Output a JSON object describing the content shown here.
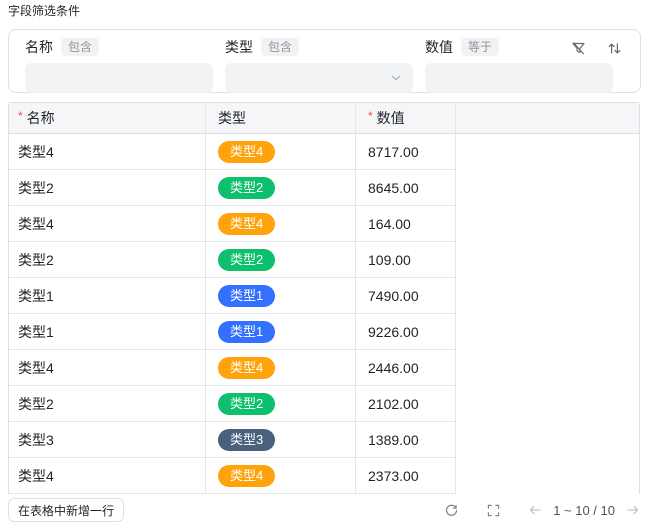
{
  "page": {
    "title": "字段筛选条件"
  },
  "filter": {
    "fields": [
      {
        "label": "名称",
        "operator": "包含",
        "control": "text-input",
        "value": ""
      },
      {
        "label": "类型",
        "operator": "包含",
        "control": "select",
        "value": ""
      },
      {
        "label": "数值",
        "operator": "等于",
        "control": "text-input",
        "value": ""
      }
    ]
  },
  "table": {
    "columns": [
      {
        "label": "名称",
        "required": true
      },
      {
        "label": "类型",
        "required": false
      },
      {
        "label": "数值",
        "required": true
      },
      {
        "label": "",
        "required": false
      }
    ],
    "badge_colors": {
      "类型1": "#3370FF",
      "类型2": "#0DC06E",
      "类型3": "#4A617E",
      "类型4": "#FFA30D"
    },
    "rows": [
      {
        "name": "类型4",
        "type": "类型4",
        "value": "8717.00"
      },
      {
        "name": "类型2",
        "type": "类型2",
        "value": "8645.00"
      },
      {
        "name": "类型4",
        "type": "类型4",
        "value": "164.00"
      },
      {
        "name": "类型2",
        "type": "类型2",
        "value": "109.00"
      },
      {
        "name": "类型1",
        "type": "类型1",
        "value": "7490.00"
      },
      {
        "name": "类型1",
        "type": "类型1",
        "value": "9226.00"
      },
      {
        "name": "类型4",
        "type": "类型4",
        "value": "2446.00"
      },
      {
        "name": "类型2",
        "type": "类型2",
        "value": "2102.00"
      },
      {
        "name": "类型3",
        "type": "类型3",
        "value": "1389.00"
      },
      {
        "name": "类型4",
        "type": "类型4",
        "value": "2373.00"
      }
    ]
  },
  "footer": {
    "add_row_label": "在表格中新增一行",
    "pagination": "1 ~ 10 / 10"
  },
  "colors": {
    "text_primary": "#1F2329",
    "text_secondary": "#646A73",
    "border": "#DEE0E3",
    "row_border": "#E5E6E8",
    "header_bg": "#F5F6F7",
    "input_bg": "#F2F3F5",
    "tag_bg": "#F1F2F3",
    "tag_text": "#8F959E",
    "required_red": "#F54A45",
    "icon_gray": "#646A73",
    "disabled_arrow": "#BFC3C9"
  }
}
